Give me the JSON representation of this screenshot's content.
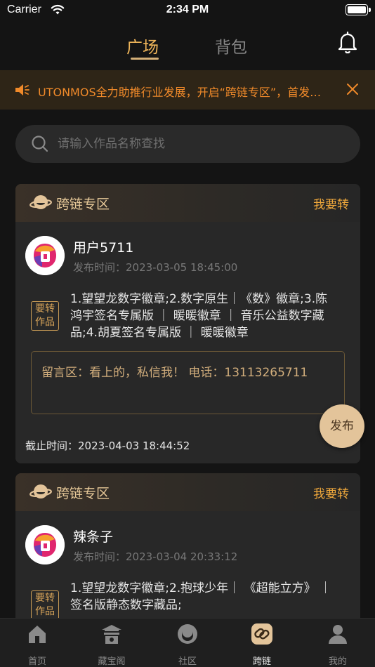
{
  "status_bar": {
    "carrier": "Carrier",
    "time": "2:34 PM"
  },
  "top_nav": {
    "tabs": [
      {
        "label": "广场",
        "active": true
      },
      {
        "label": "背包",
        "active": false
      }
    ]
  },
  "notice": {
    "text": "UTONMOS全力助推行业发展，开启“跨链专区”，首发…"
  },
  "search": {
    "placeholder": "请输入作品名称查找",
    "value": ""
  },
  "cards": [
    {
      "title": "跨链专区",
      "action": "我要转",
      "user": "用户5711",
      "post_time": "发布时间：2023-03-05 18:45:00",
      "tag": "要转作品",
      "works": "1.望望龙数字徽章;2.数字原生｜《数》徽章;3.陈鸿宇签名专属版 ｜ 暖暖徽章 ｜ 音乐公益数字藏品;4.胡夏签名专属版 ｜ 暖暖徽章",
      "message": "留言区：看上的，私信我！ 电话：13113265711",
      "deadline": "截止时间：2023-04-03 18:44:52"
    },
    {
      "title": "跨链专区",
      "action": "我要转",
      "user": "辣条子",
      "post_time": "发布时间：2023-03-04 20:33:12",
      "tag": "要转作品",
      "works": "1.望望龙数字徽章;2.抱球少年｜ 《超能立方》 ｜ 签名版静态数字藏品;"
    }
  ],
  "publish_button": "发布",
  "tabbar": [
    {
      "label": "首页",
      "icon": "home-icon",
      "active": false
    },
    {
      "label": "藏宝阁",
      "icon": "pavilion-icon",
      "active": false
    },
    {
      "label": "社区",
      "icon": "community-icon",
      "active": false
    },
    {
      "label": "跨链",
      "icon": "cross-chain-icon",
      "active": true
    },
    {
      "label": "我的",
      "icon": "profile-icon",
      "active": false
    }
  ],
  "colors": {
    "accent": "#f0b65a",
    "notice_text": "#f08a2a",
    "background": "#141414"
  }
}
